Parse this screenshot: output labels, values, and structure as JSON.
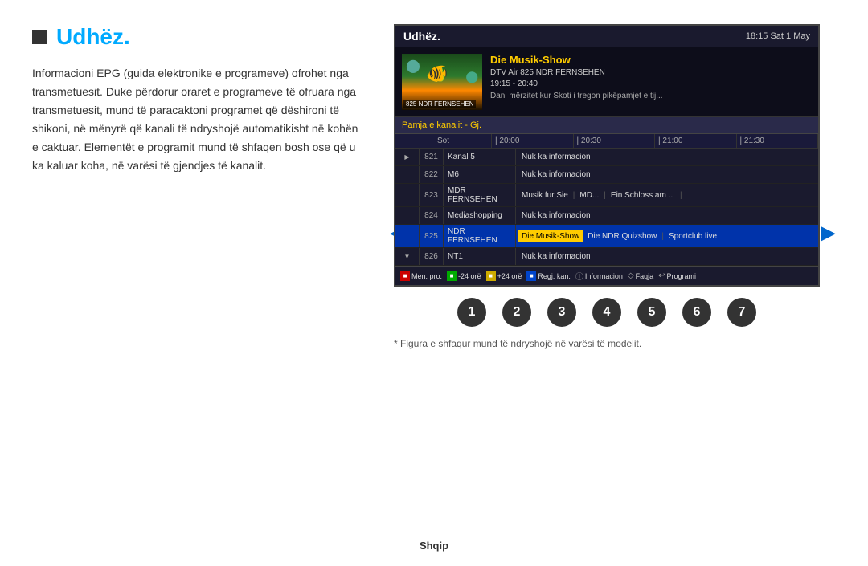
{
  "page": {
    "title": "Udhëz.",
    "title_square": "■",
    "language": "Shqip"
  },
  "left": {
    "body_text": "Informacioni EPG (guida elektronike e programeve) ofrohet nga transmetuesit. Duke përdorur oraret e programeve të ofruara nga transmetuesit, mund të paracaktoni programet që dëshironi të shikoni, në mënyrë që kanali të ndryshojë automatikisht në kohën e caktuar. Elementët e programit mund të shfaqen bosh ose që u ka kaluar koha, në varësi të gjendjes të kanalit."
  },
  "epg": {
    "header": {
      "title": "Udhëz.",
      "time": "18:15 Sat 1 May"
    },
    "preview": {
      "channel_label": "825 NDR FERNSEHEN",
      "show_title": "Die Musik-Show",
      "channel_info": "DTV Air 825 NDR FERNSEHEN",
      "time_range": "19:15 - 20:40",
      "description": "Dani mërzitet kur Skoti i tregon pikëpamjet e tij..."
    },
    "guide_bar": "Pamja e kanalit - Gj.",
    "time_header": {
      "col_label": "Sot",
      "times": [
        "20:00",
        "20:30",
        "21:00",
        "21:30"
      ]
    },
    "channels": [
      {
        "num": "821",
        "name": "Kanal 5",
        "programs": [
          {
            "text": "Nuk ka informacion",
            "type": "normal"
          }
        ],
        "arrow": "right"
      },
      {
        "num": "822",
        "name": "M6",
        "programs": [
          {
            "text": "Nuk ka informacion",
            "type": "normal"
          }
        ],
        "arrow": ""
      },
      {
        "num": "823",
        "name": "MDR FERNSEHEN",
        "programs": [
          {
            "text": "Musik fur Sie",
            "type": "normal"
          },
          {
            "text": "|",
            "type": "sep"
          },
          {
            "text": "MD...",
            "type": "normal"
          },
          {
            "text": "|",
            "type": "sep"
          },
          {
            "text": "Ein Schloss am ...",
            "type": "normal"
          },
          {
            "text": "|",
            "type": "sep"
          }
        ],
        "arrow": ""
      },
      {
        "num": "824",
        "name": "Mediashopping",
        "programs": [
          {
            "text": "Nuk ka informacion",
            "type": "normal"
          }
        ],
        "arrow": ""
      },
      {
        "num": "825",
        "name": "NDR FERNSEHEN",
        "programs": [
          {
            "text": "Die Musik-Show",
            "type": "highlight"
          },
          {
            "text": "Die NDR Quizshow",
            "type": "normal"
          },
          {
            "text": "|",
            "type": "sep"
          },
          {
            "text": "Sportclub live",
            "type": "normal"
          }
        ],
        "arrow": "",
        "active": true
      },
      {
        "num": "826",
        "name": "NT1",
        "programs": [
          {
            "text": "Nuk ka informacion",
            "type": "normal"
          }
        ],
        "arrow": "down"
      }
    ],
    "toolbar": [
      {
        "color": "red",
        "label": "Men. pro."
      },
      {
        "color": "green",
        "label": "-24 orë"
      },
      {
        "color": "yellow",
        "label": "+24 orë"
      },
      {
        "color": "blue",
        "label": "Regj. kan."
      },
      {
        "icon": "i",
        "label": "Informacion"
      },
      {
        "icon": "◇",
        "label": "Faqja"
      },
      {
        "icon": "↩",
        "label": "Programi"
      }
    ]
  },
  "circles": [
    "1",
    "2",
    "3",
    "4",
    "5",
    "6",
    "7"
  ],
  "footnote": "* Figura e shfaqur mund të ndryshojë në varësi të modelit."
}
